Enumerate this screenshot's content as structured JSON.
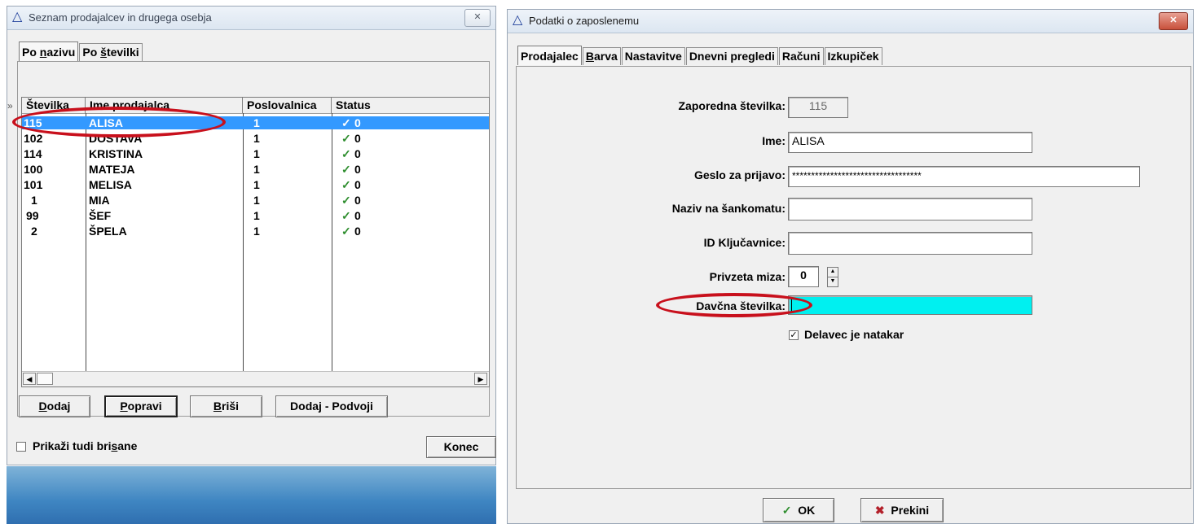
{
  "left_window": {
    "title": "Seznam prodajalcev in drugega osebja",
    "close_label": "✕",
    "tabs": [
      {
        "pre": "Po ",
        "ul": "n",
        "post": "azivu"
      },
      {
        "pre": "Po ",
        "ul": "š",
        "post": "tevilki"
      }
    ],
    "scroll_marker": "»",
    "columns": [
      "Številka",
      "Ime prodajalca",
      "Poslovalnica",
      "Status"
    ],
    "rows": [
      {
        "num": "115",
        "name": "ALISA",
        "branch": "1",
        "status": "0",
        "selected": true
      },
      {
        "num": "102",
        "name": "DOSTAVA",
        "branch": "1",
        "status": "0"
      },
      {
        "num": "114",
        "name": "KRISTINA",
        "branch": "1",
        "status": "0"
      },
      {
        "num": "100",
        "name": "MATEJA",
        "branch": "1",
        "status": "0"
      },
      {
        "num": "101",
        "name": "MELISA",
        "branch": "1",
        "status": "0"
      },
      {
        "num": "1",
        "name": "MIA",
        "branch": "1",
        "status": "0"
      },
      {
        "num": "99",
        "name": "ŠEF",
        "branch": "1",
        "status": "0"
      },
      {
        "num": "2",
        "name": "ŠPELA",
        "branch": "1",
        "status": "0"
      }
    ],
    "status_check": "✓",
    "scroll_left": "◀",
    "scroll_right": "▶",
    "buttons": {
      "add": {
        "ul": "D",
        "post": "odaj"
      },
      "edit": {
        "ul": "P",
        "post": "opravi"
      },
      "delete": {
        "ul": "B",
        "post": "riši"
      },
      "duplicate": "Dodaj - Podvoji"
    },
    "show_deleted": {
      "pre": "Prikaži tudi bri",
      "ul": "s",
      "post": "ane",
      "checked": false
    },
    "close_button": "Konec"
  },
  "right_window": {
    "title": "Podatki o zaposlenemu",
    "close_label": "✕",
    "tabs": [
      {
        "label": "Prodajalec",
        "ul_index": null,
        "active": true
      },
      {
        "pre": "",
        "ul": "B",
        "post": "arva"
      },
      {
        "label": "Nastavitve"
      },
      {
        "label": "Dnevni pregledi"
      },
      {
        "label": "Računi"
      },
      {
        "label": "Izkupiček"
      }
    ],
    "fields": {
      "seq_label": "Zaporedna številka:",
      "seq_value": "115",
      "name_label": "Ime:",
      "name_value": "ALISA",
      "password_label": "Geslo za prijavo:",
      "password_value": "**********************************",
      "bar_name_label": "Naziv na šankomatu:",
      "bar_name_value": "",
      "key_id_label": "ID Ključavnice:",
      "key_id_value": "",
      "table_label": "Privzeta miza:",
      "table_value": "0",
      "tax_label": "Davčna številka:",
      "tax_value": ""
    },
    "waiter_checkbox": {
      "label": "Delavec je natakar",
      "checked": true
    },
    "ok_button": "OK",
    "cancel_button": "Prekini",
    "ok_icon": "✓",
    "cancel_icon": "✖",
    "spin_up": "▲",
    "spin_down": "▼"
  },
  "colors": {
    "selection": "#3399ff",
    "highlight_ellipse": "#c8101c",
    "tax_field": "#00f0f0",
    "check_green": "#2d8d2d"
  }
}
